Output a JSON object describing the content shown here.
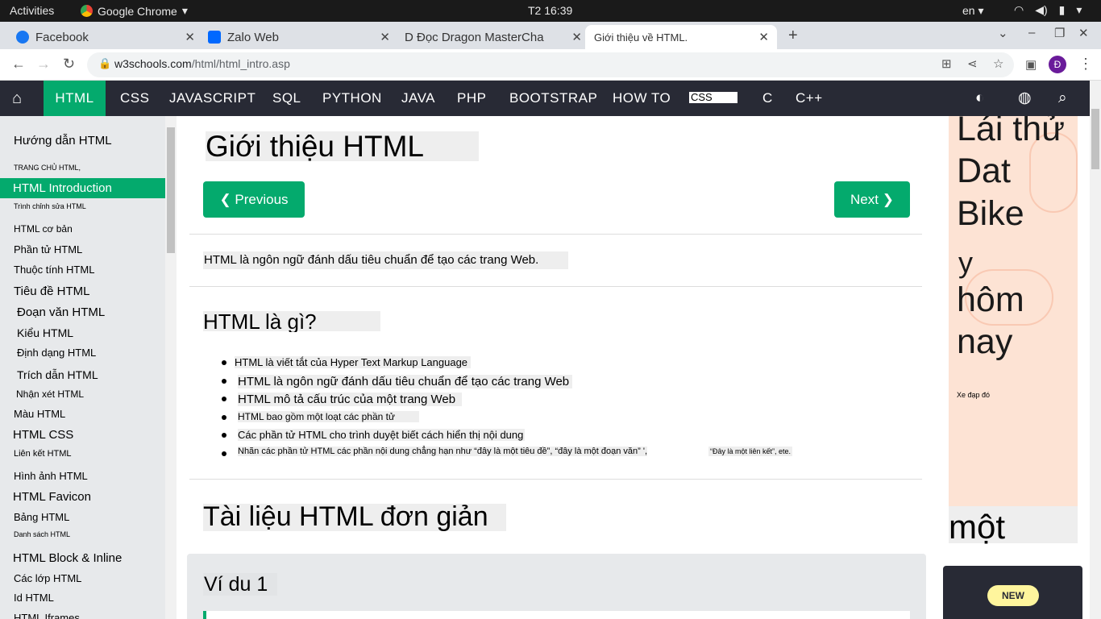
{
  "os_bar": {
    "activities": "Activities",
    "app_name": "Google Chrome",
    "clock": "T2 16:39",
    "lang": "en"
  },
  "tabs": [
    {
      "label": "Facebook",
      "color": "#1877f2"
    },
    {
      "label": "Zalo Web",
      "color": "#0068ff"
    },
    {
      "label": "D Đọc Dragon MasterCha",
      "color": "#888888"
    },
    {
      "label": "Giới thiệu về HTML.",
      "color": "#04aa6d"
    }
  ],
  "address": {
    "domain": "w3schools.com",
    "path": "/html/html_intro.asp",
    "avatar_letter": "Đ"
  },
  "w3nav": {
    "items": [
      "HTML",
      "CSS",
      "JAVASCRIPT",
      "SQL",
      "PYTHON",
      "JAVA",
      "PHP",
      "BOOTSTRAP",
      "HOW TO",
      "CSS",
      "C",
      "C++"
    ]
  },
  "sidebar": {
    "items": [
      "Hướng dẫn HTML",
      "TRANG CHỦ HTML,",
      "HTML Introduction",
      "Trình chỉnh sửa HTML",
      "HTML cơ bản",
      "Phần tử HTML",
      "Thuộc tính HTML",
      "Tiêu đề HTML",
      "Đoạn văn HTML",
      "Kiểu HTML",
      "Định dạng HTML",
      "Trích dẫn HTML",
      "Nhận xét HTML",
      "Màu HTML",
      "HTML CSS",
      "Liên kết HTML",
      "Hình ảnh HTML",
      "HTML Favicon",
      "Bảng HTML",
      "Danh sách HTML",
      "HTML Block & Inline",
      "Các lớp HTML",
      "Id HTML",
      "HTML Iframes"
    ]
  },
  "main": {
    "title": "Giới thiệu HTML",
    "prev_label": "❮ Previous",
    "next_label": "Next ❯",
    "intro": "HTML là ngôn ngữ đánh dấu tiêu chuẩn để tạo các trang Web.",
    "what_heading": "HTML là gì?",
    "bullets": [
      "HTML là viết tắt của Hyper Text Markup Language",
      "HTML là ngôn ngữ đánh dấu tiêu chuẩn để tạo các trang Web",
      "HTML mô tả cấu trúc của một trang Web",
      "HTML bao gồm một loạt các phần tử",
      "Các phần tử HTML cho trình duyệt biết cách hiển thị nội dung",
      "Nhãn các phần tử HTML các phần nội dung chẳng hạn như “đây là một tiêu đề”, “đây là một đoạn văn” ',"
    ],
    "bullet_tail": "“Đây là một liên kết”, ete.",
    "doc_heading": "Tài liệu HTML đơn giản",
    "example_heading": "Ví du 1"
  },
  "ad": {
    "lines": [
      "Lái thử",
      "Dat",
      "Bike",
      "y",
      "hôm",
      "nay"
    ],
    "small": "Xe đạp đó",
    "bottom_word": "một",
    "new_badge": "NEW"
  }
}
